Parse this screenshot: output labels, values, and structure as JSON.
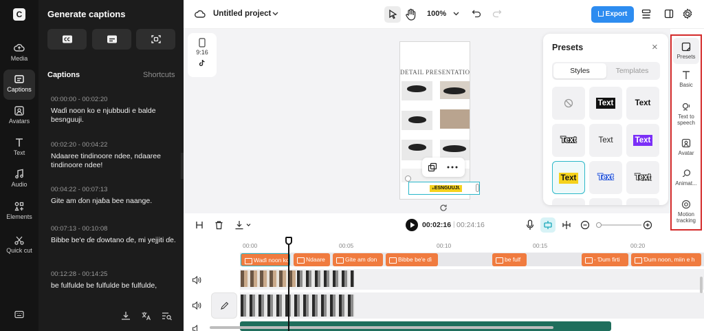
{
  "rail": {
    "logo": "C",
    "items": [
      {
        "label": "Media",
        "icon": "cloud-upload-icon"
      },
      {
        "label": "Captions",
        "icon": "captions-icon",
        "active": true
      },
      {
        "label": "Avatars",
        "icon": "avatar-icon"
      },
      {
        "label": "Text",
        "icon": "text-icon"
      },
      {
        "label": "Audio",
        "icon": "music-note-icon"
      },
      {
        "label": "Elements",
        "icon": "elements-icon"
      },
      {
        "label": "Quick cut",
        "icon": "quick-cut-icon"
      }
    ]
  },
  "panel": {
    "title": "Generate captions",
    "captions_heading": "Captions",
    "shortcuts_label": "Shortcuts",
    "captions": [
      {
        "time": "00:00:00 - 00:02:20",
        "text": "Waɗi noon ko e njubbudi e balde besnguuji."
      },
      {
        "time": "00:02:20 - 00:04:22",
        "text": "Ndaaree tindinoore ndee, ndaaree tindinoore ndee!"
      },
      {
        "time": "00:04:22 - 00:07:13",
        "text": "Gite am ɗon njaɓa bee naange."
      },
      {
        "time": "00:07:13 - 00:10:08",
        "text": "Bibbe be'e ɗe ɗowtano ɗe, mi yejjiti ɗe."
      },
      {
        "time": "00:12:28 - 00:14:25",
        "text": "be fulfulde be fulfulde be fulfulde,"
      }
    ]
  },
  "topbar": {
    "project_title": "Untitled project",
    "zoom": "100%",
    "export_label": "Export"
  },
  "canvas": {
    "ratio_label": "9:16",
    "phone_title": "DETAIL PRESENTATION",
    "caption_chip": "₊ESNGUUJI."
  },
  "presets": {
    "title": "Presets",
    "close": "×",
    "tab_styles": "Styles",
    "tab_templates": "Templates",
    "tile_text": "Text"
  },
  "right_bar": {
    "items": [
      {
        "label": "Presets",
        "active": true
      },
      {
        "label": "Basic"
      },
      {
        "label": "Text to speech"
      },
      {
        "label": "Avatar"
      },
      {
        "label": "Animat..."
      },
      {
        "label": "Motion tracking"
      }
    ]
  },
  "timeline": {
    "current_time": "00:02:16",
    "separator": "|",
    "duration": "00:24:16",
    "ruler": [
      "00:00",
      "00:05",
      "00:10",
      "00:15",
      "00:20"
    ],
    "clips": [
      "Waɗi noon ko e",
      "Ndaare",
      "Gite am ɗon",
      "Bibbe be'e ɗi",
      "be fulf",
      "- Ɗum firti",
      "Ɗum noon, miin e h"
    ]
  },
  "colors": {
    "accent": "#2d8cf0",
    "caption_clip": "#f07b3f",
    "selection": "#2bb8c8",
    "highlight_box": "#d42a2a"
  }
}
